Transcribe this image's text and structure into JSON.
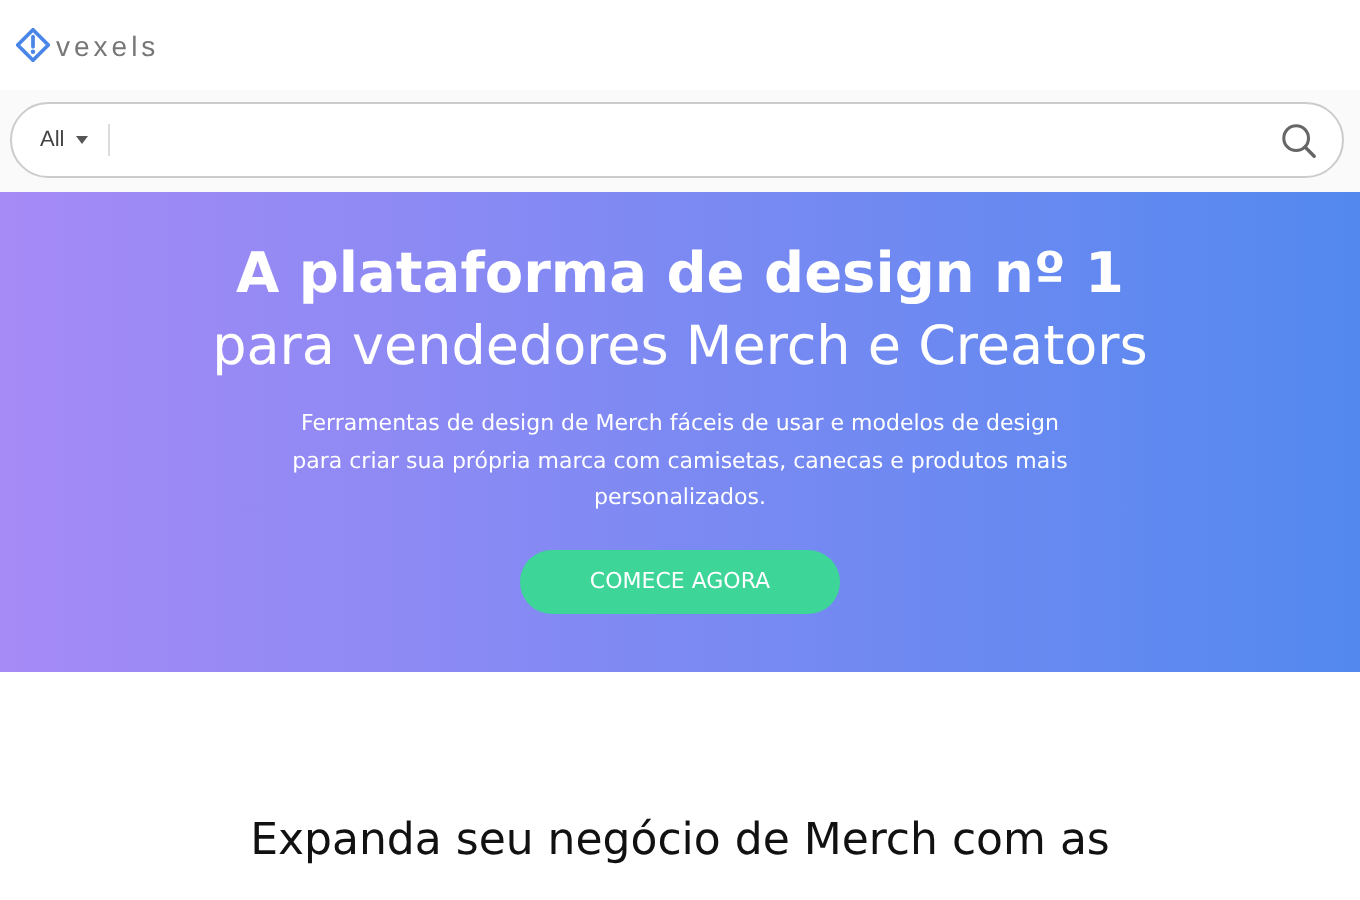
{
  "header": {
    "logo": "vexels"
  },
  "search": {
    "category": "All"
  },
  "hero": {
    "title_line_1": "A plataforma de design nº 1",
    "title_line_2": "para vendedores Merch e Creators",
    "description": "Ferramentas de design de Merch fáceis de usar e modelos de design para criar sua própria marca com camisetas, canecas e produtos mais personalizados.",
    "button": "COMECE AGORA"
  },
  "section": {
    "heading": "Expanda seu negócio de Merch com as"
  }
}
